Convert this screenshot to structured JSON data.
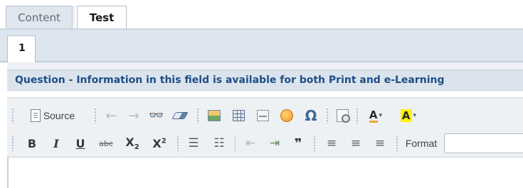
{
  "top_tabs": [
    {
      "label": "Content",
      "active": false
    },
    {
      "label": "Test",
      "active": true
    }
  ],
  "sub_tabs": [
    {
      "label": "1",
      "active": true
    }
  ],
  "panel": {
    "title": "Question - Information in this field is available for both Print and e-Learning"
  },
  "toolbar": {
    "source_label": "Source",
    "format_label": "Format",
    "bold": "B",
    "italic": "I",
    "underline": "U",
    "strike": "abc",
    "subscript_base": "X",
    "subscript_mark": "2",
    "superscript_base": "X",
    "superscript_mark": "2",
    "special_char": "Ω",
    "text_color_letter": "A",
    "bg_color_letter": "A",
    "blockquote": "❞",
    "icons": [
      "source-icon",
      "undo-icon",
      "redo-icon",
      "find-icon",
      "eraser-icon",
      "image-icon",
      "table-icon",
      "horizontal-rule-icon",
      "smiley-icon",
      "special-char-icon",
      "preview-icon",
      "text-color-icon",
      "bg-color-icon",
      "bold-icon",
      "italic-icon",
      "underline-icon",
      "strikethrough-icon",
      "subscript-icon",
      "superscript-icon",
      "numbered-list-icon",
      "bulleted-list-icon",
      "outdent-icon",
      "indent-icon",
      "blockquote-icon",
      "align-left-icon",
      "align-center-icon",
      "align-right-icon"
    ]
  },
  "colors": {
    "panel_title": "#1f4e86",
    "panel_header_bg": "#dbe4ed",
    "tab_bar_bg": "#dde5ee",
    "highlight_yellow": "#fff200"
  }
}
